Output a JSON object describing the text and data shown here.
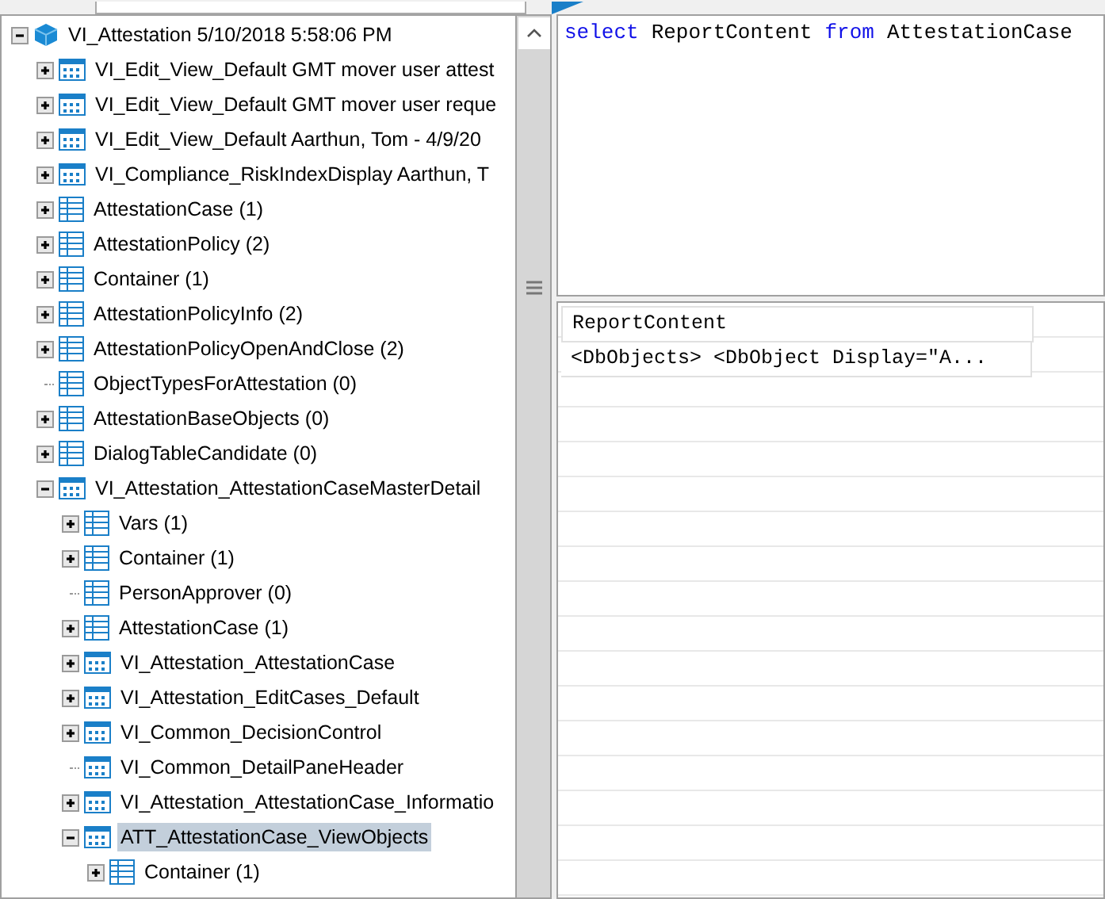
{
  "tree": [
    {
      "label": "VI_Attestation 5/10/2018 5:58:06 PM",
      "kind": "database",
      "expandable": true,
      "expanded": true,
      "selected": false,
      "children": [
        {
          "label": "VI_Edit_View_Default GMT mover user attest",
          "kind": "view",
          "expandable": true,
          "expanded": false,
          "selected": false
        },
        {
          "label": "VI_Edit_View_Default GMT mover user reque",
          "kind": "view",
          "expandable": true,
          "expanded": false,
          "selected": false
        },
        {
          "label": "VI_Edit_View_Default Aarthun, Tom - 4/9/20",
          "kind": "view",
          "expandable": true,
          "expanded": false,
          "selected": false
        },
        {
          "label": "VI_Compliance_RiskIndexDisplay Aarthun, T",
          "kind": "view",
          "expandable": true,
          "expanded": false,
          "selected": false
        },
        {
          "label": "AttestationCase (1)",
          "kind": "table",
          "expandable": true,
          "expanded": false,
          "selected": false
        },
        {
          "label": "AttestationPolicy (2)",
          "kind": "table",
          "expandable": true,
          "expanded": false,
          "selected": false
        },
        {
          "label": "Container (1)",
          "kind": "table",
          "expandable": true,
          "expanded": false,
          "selected": false
        },
        {
          "label": "AttestationPolicyInfo (2)",
          "kind": "table",
          "expandable": true,
          "expanded": false,
          "selected": false
        },
        {
          "label": "AttestationPolicyOpenAndClose (2)",
          "kind": "table",
          "expandable": true,
          "expanded": false,
          "selected": false
        },
        {
          "label": "ObjectTypesForAttestation (0)",
          "kind": "table",
          "expandable": false,
          "expanded": false,
          "selected": false
        },
        {
          "label": "AttestationBaseObjects (0)",
          "kind": "table",
          "expandable": true,
          "expanded": false,
          "selected": false
        },
        {
          "label": "DialogTableCandidate (0)",
          "kind": "table",
          "expandable": true,
          "expanded": false,
          "selected": false
        },
        {
          "label": "VI_Attestation_AttestationCaseMasterDetail",
          "kind": "view",
          "expandable": true,
          "expanded": true,
          "selected": false,
          "children": [
            {
              "label": "Vars (1)",
              "kind": "table",
              "expandable": true,
              "expanded": false,
              "selected": false
            },
            {
              "label": "Container (1)",
              "kind": "table",
              "expandable": true,
              "expanded": false,
              "selected": false
            },
            {
              "label": "PersonApprover (0)",
              "kind": "table",
              "expandable": false,
              "expanded": false,
              "selected": false
            },
            {
              "label": "AttestationCase (1)",
              "kind": "table",
              "expandable": true,
              "expanded": false,
              "selected": false
            },
            {
              "label": "VI_Attestation_AttestationCase",
              "kind": "view",
              "expandable": true,
              "expanded": false,
              "selected": false
            },
            {
              "label": "VI_Attestation_EditCases_Default",
              "kind": "view",
              "expandable": true,
              "expanded": false,
              "selected": false
            },
            {
              "label": "VI_Common_DecisionControl",
              "kind": "view",
              "expandable": true,
              "expanded": false,
              "selected": false
            },
            {
              "label": "VI_Common_DetailPaneHeader",
              "kind": "view",
              "expandable": false,
              "expanded": false,
              "selected": false
            },
            {
              "label": "VI_Attestation_AttestationCase_Informatio",
              "kind": "view",
              "expandable": true,
              "expanded": false,
              "selected": false
            },
            {
              "label": "ATT_AttestationCase_ViewObjects",
              "kind": "view",
              "expandable": true,
              "expanded": true,
              "selected": true,
              "children": [
                {
                  "label": "Container (1)",
                  "kind": "table",
                  "expandable": true,
                  "expanded": false,
                  "selected": false
                }
              ]
            }
          ]
        }
      ]
    }
  ],
  "query": [
    {
      "text": "select",
      "kind": "keyword"
    },
    {
      "text": "ReportContent",
      "kind": "name"
    },
    {
      "text": "from",
      "kind": "keyword"
    },
    {
      "text": "AttestationCase",
      "kind": "name"
    }
  ],
  "results": {
    "columns": [
      "ReportContent"
    ],
    "rows": [
      [
        "<DbObjects>  <DbObject Display=\"A..."
      ]
    ]
  }
}
